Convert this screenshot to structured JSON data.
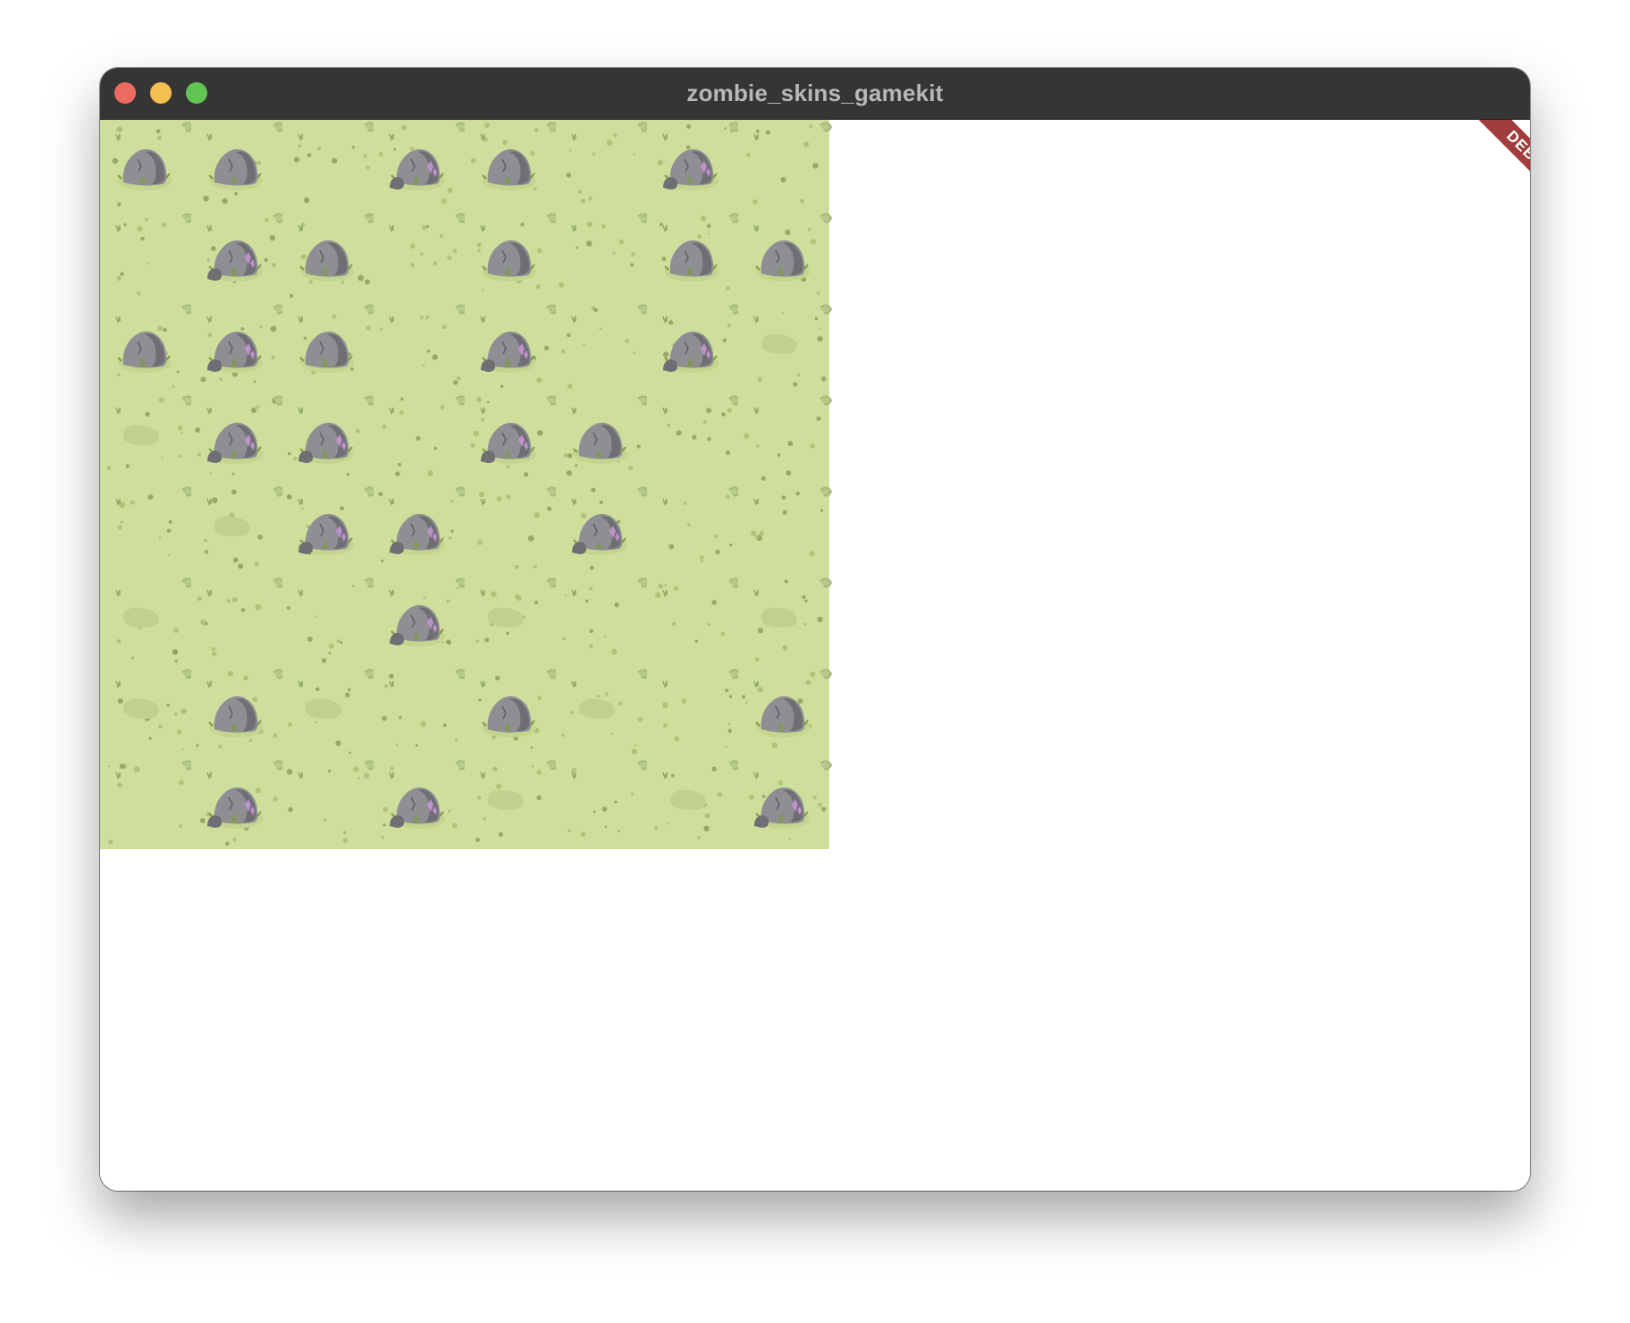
{
  "window": {
    "title": "zombie_skins_gamekit",
    "controls": [
      {
        "name": "close",
        "color": "#ed6a5e"
      },
      {
        "name": "minimize",
        "color": "#f4bf4f"
      },
      {
        "name": "maximize",
        "color": "#61c554"
      }
    ]
  },
  "debug_banner": {
    "label": "DEBUG",
    "color": "#a13c3c"
  },
  "colors": {
    "grass": "#cddf9b",
    "grass_dark": "#b9cc84",
    "rock": "#8f8f93",
    "rock_shadow": "#6e6e73",
    "crystal": "#c894d6"
  },
  "board": {
    "rows": 8,
    "cols": 8,
    "legend": {
      "E": "grass",
      "R": "rock",
      "C": "rock-with-crystal",
      "P": "grass-with-patch"
    },
    "tiles": [
      [
        "R",
        "R",
        "E",
        "C",
        "R",
        "E",
        "C",
        "E"
      ],
      [
        "E",
        "C",
        "R",
        "E",
        "R",
        "E",
        "R",
        "R"
      ],
      [
        "R",
        "C",
        "R",
        "E",
        "C",
        "E",
        "C",
        "P"
      ],
      [
        "P",
        "C",
        "C",
        "E",
        "C",
        "R",
        "E",
        "E"
      ],
      [
        "E",
        "P",
        "C",
        "C",
        "E",
        "C",
        "E",
        "E"
      ],
      [
        "P",
        "E",
        "E",
        "C",
        "P",
        "E",
        "E",
        "P"
      ],
      [
        "P",
        "R",
        "P",
        "E",
        "R",
        "P",
        "E",
        "R"
      ],
      [
        "E",
        "C",
        "E",
        "C",
        "P",
        "E",
        "P",
        "C"
      ]
    ]
  }
}
